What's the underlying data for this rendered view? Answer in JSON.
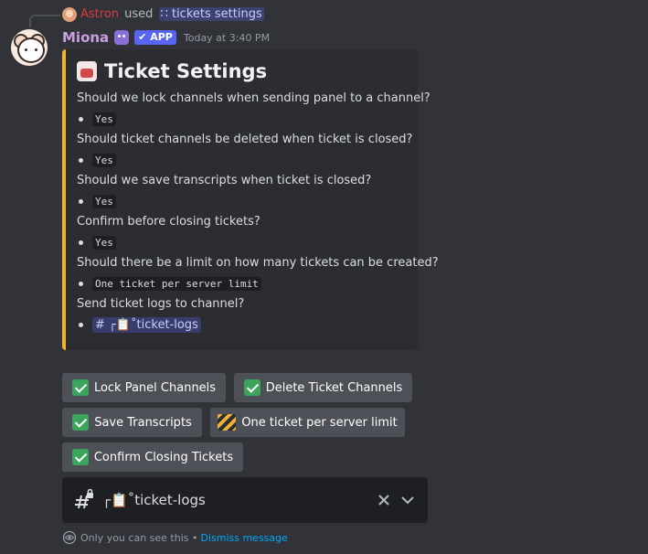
{
  "reply": {
    "user": "Astron",
    "used_text": "used",
    "command": "∷ tickets settings"
  },
  "message": {
    "username": "Miona",
    "app_tag": "✔ APP",
    "timestamp": "Today at 3:40 PM"
  },
  "embed": {
    "accent_color": "#f0b232",
    "title": "Ticket Settings",
    "title_icon": "ticket-emoji",
    "fields": [
      {
        "question": "Should we lock channels when sending panel to a channel?",
        "answer": "Yes"
      },
      {
        "question": "Should ticket channels be deleted when ticket is closed?",
        "answer": "Yes"
      },
      {
        "question": "Should we save transcripts when ticket is closed?",
        "answer": "Yes"
      },
      {
        "question": "Confirm before closing tickets?",
        "answer": "Yes"
      },
      {
        "question": "Should there be a limit on how many tickets can be created?",
        "answer": "One ticket per server limit"
      },
      {
        "question": "Send ticket logs to channel?",
        "answer": "# ┌📋˚ticket-logs"
      }
    ]
  },
  "buttons": {
    "lock_panel": "Lock Panel Channels",
    "delete_tickets": "Delete Ticket Channels",
    "save_transcripts": "Save Transcripts",
    "ticket_limit": "One ticket per server limit",
    "confirm_closing": "Confirm Closing Tickets"
  },
  "select": {
    "value": "┌📋˚ticket-logs"
  },
  "footer": {
    "note": "Only you can see this •",
    "dismiss": "Dismiss message"
  }
}
